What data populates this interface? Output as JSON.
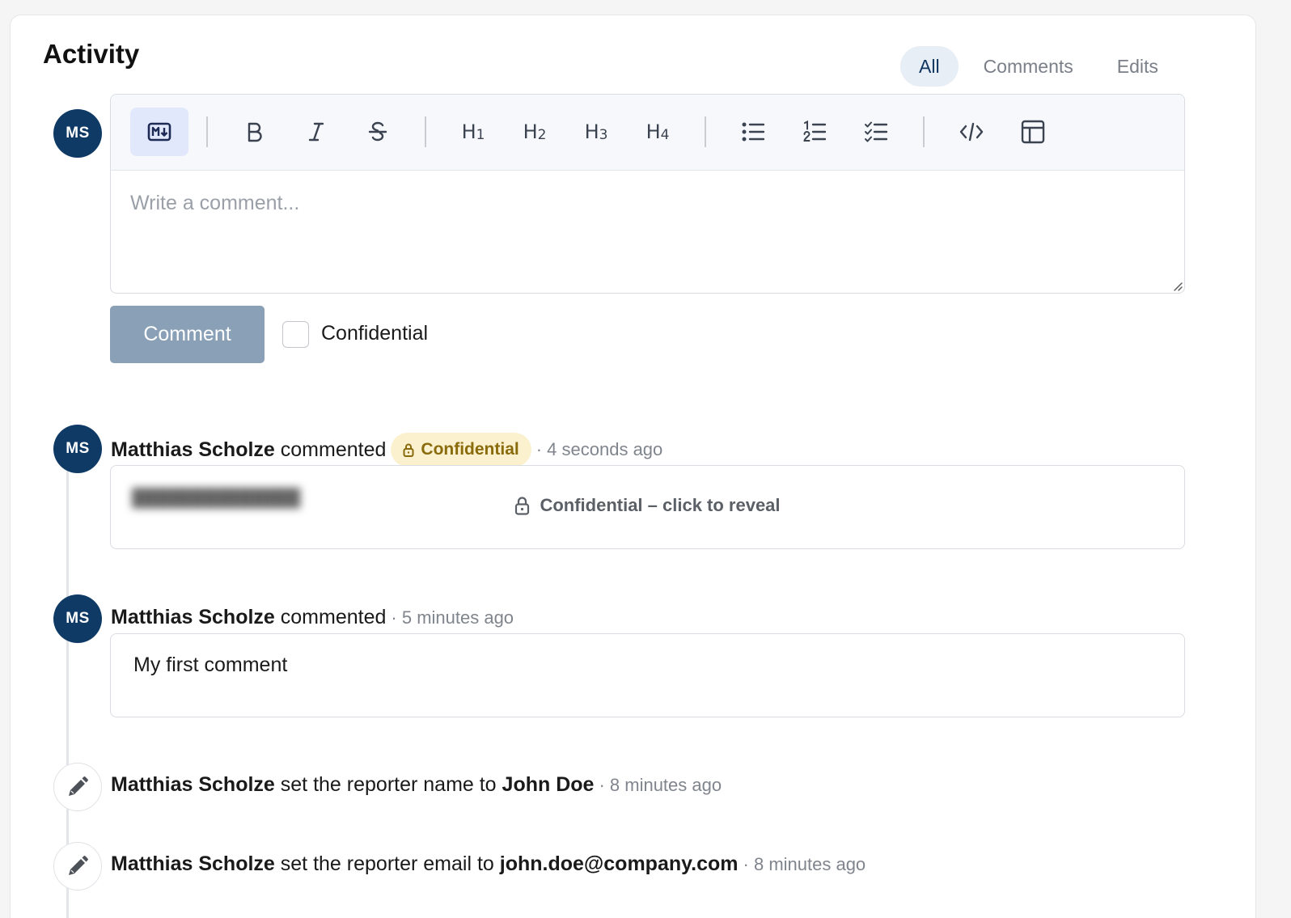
{
  "title": "Activity",
  "tabs": [
    {
      "label": "All",
      "active": true
    },
    {
      "label": "Comments",
      "active": false
    },
    {
      "label": "Edits",
      "active": false
    }
  ],
  "user_initials": "MS",
  "editor": {
    "toolbar": [
      "markdown-icon",
      "bold-icon",
      "italic-icon",
      "strikethrough-icon",
      "h1",
      "h2",
      "h3",
      "h4",
      "bullet-list-icon",
      "numbered-list-icon",
      "checklist-icon",
      "code-icon",
      "table-icon"
    ],
    "headings": {
      "h": "H",
      "n1": "1",
      "n2": "2",
      "n3": "3",
      "n4": "4"
    },
    "placeholder": "Write a comment..."
  },
  "actions": {
    "comment_label": "Comment",
    "confidential_label": "Confidential"
  },
  "activity": [
    {
      "author": "Matthias Scholze",
      "verb": "commented",
      "badge": "Confidential",
      "time": "· 4 seconds ago",
      "reveal_text": "Confidential – click to reveal"
    },
    {
      "author": "Matthias Scholze",
      "verb": "commented",
      "time": "· 5 minutes ago",
      "body": "My first comment"
    },
    {
      "author": "Matthias Scholze",
      "verb": "set the reporter name to",
      "value": "John Doe",
      "time": "· 8 minutes ago"
    },
    {
      "author": "Matthias Scholze",
      "verb": "set the reporter email to",
      "value": "john.doe@company.com",
      "time": "· 8 minutes ago"
    }
  ],
  "colors": {
    "avatar": "#0f3a66",
    "tab_active_bg": "#e8eef6",
    "button": "#8aa0b6",
    "badge_bg": "#fbf1cf",
    "badge_text": "#8a6b0c"
  }
}
